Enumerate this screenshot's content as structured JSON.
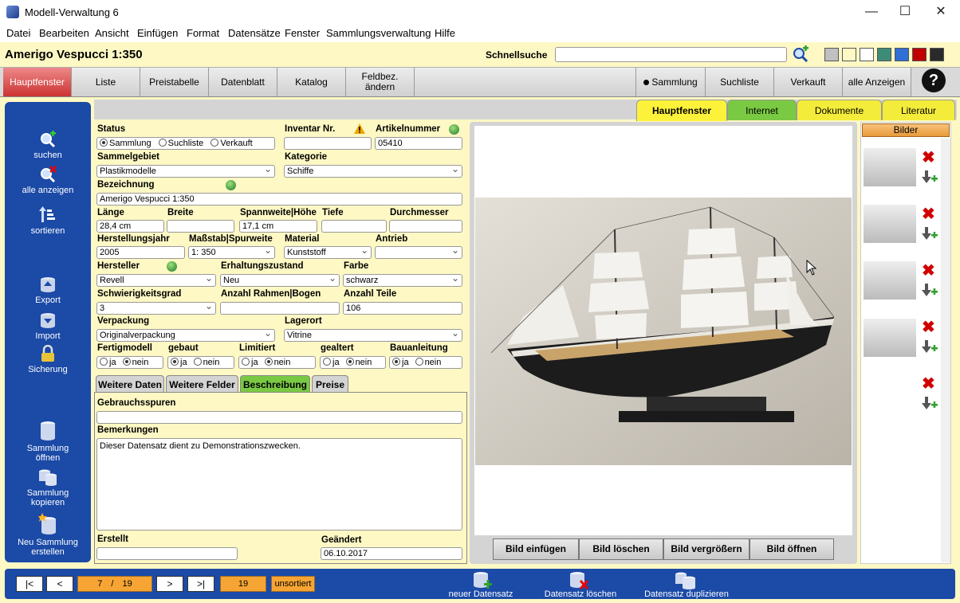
{
  "window": {
    "title": "Modell-Verwaltung 6",
    "min": "—",
    "max": "☐",
    "close": "✕"
  },
  "menu": [
    "Datei",
    "Bearbeiten",
    "Ansicht",
    "Einfügen",
    "Format",
    "Datensätze",
    "Fenster",
    "Sammlungsverwaltung",
    "Hilfe"
  ],
  "header": {
    "record_title": "Amerigo Vespucci 1:350",
    "quicksearch_label": "Schnellsuche",
    "quicksearch_value": ""
  },
  "swatches": [
    "#c0c0c0",
    "#fdf8c4",
    "#ffffff",
    "#3d8c7a",
    "#2f6fd6",
    "#c00000",
    "#2a2a2a"
  ],
  "nav": {
    "hauptfenster": "Hauptfenster",
    "liste": "Liste",
    "preistabelle": "Preistabelle",
    "datenblatt": "Datenblatt",
    "katalog": "Katalog",
    "feldbez1": "Feldbez.",
    "feldbez2": "ändern",
    "sammlung": "Sammlung",
    "suchliste": "Suchliste",
    "verkauft": "Verkauft",
    "alle": "alle Anzeigen",
    "help": "?"
  },
  "sidebar": {
    "suchen": "suchen",
    "alle": "alle anzeigen",
    "sortieren": "sortieren",
    "export": "Export",
    "import": "Import",
    "sicherung": "Sicherung",
    "oeffnen1": "Sammlung",
    "oeffnen2": "öffnen",
    "kopieren1": "Sammlung",
    "kopieren2": "kopieren",
    "neu1": "Neu Sammlung",
    "neu2": "erstellen"
  },
  "rtabs": {
    "haupt": "Hauptfenster",
    "internet": "Internet",
    "dokumente": "Dokumente",
    "literatur": "Literatur"
  },
  "form": {
    "status_label": "Status",
    "status_opts": [
      "Sammlung",
      "Suchliste",
      "Verkauft"
    ],
    "inventar_label": "Inventar Nr.",
    "inventar": "",
    "artikel_label": "Artikelnummer",
    "artikel": "05410",
    "sammelgebiet_label": "Sammelgebiet",
    "sammelgebiet": "Plastikmodelle",
    "kategorie_label": "Kategorie",
    "kategorie": "Schiffe",
    "bezeichnung_label": "Bezeichnung",
    "bezeichnung": "Amerigo Vespucci 1:350",
    "laenge_label": "Länge",
    "laenge": "28,4 cm",
    "breite_label": "Breite",
    "breite": "",
    "spann_label": "Spannweite|Höhe",
    "spann": "17,1 cm",
    "tiefe_label": "Tiefe",
    "tiefe": "",
    "durch_label": "Durchmesser",
    "durch": "",
    "jahr_label": "Herstellungsjahr",
    "jahr": "2005",
    "massstab_label": "Maßstab|Spurweite",
    "massstab": "1:  350",
    "material_label": "Material",
    "material": "Kunststoff",
    "antrieb_label": "Antrieb",
    "antrieb": "",
    "hersteller_label": "Hersteller",
    "hersteller": "Revell",
    "erhaltung_label": "Erhaltungszustand",
    "erhaltung": "Neu",
    "farbe_label": "Farbe",
    "farbe": "schwarz",
    "schwierig_label": "Schwierigkeitsgrad",
    "schwierig": "3",
    "rahmen_label": "Anzahl Rahmen|Bogen",
    "rahmen": "",
    "teile_label": "Anzahl Teile",
    "teile": "106",
    "verpackung_label": "Verpackung",
    "verpackung": "Originalverpackung",
    "lagerort_label": "Lagerort",
    "lagerort": "Vitrine",
    "fertig_label": "Fertigmodell",
    "gebaut_label": "gebaut",
    "limitiert_label": "Limitiert",
    "gealtert_label": "gealtert",
    "bauanl_label": "Bauanleitung",
    "ja": "ja",
    "nein": "nein",
    "tab1": "Weitere Daten",
    "tab2": "Weitere Felder",
    "tab3": "Beschreibung",
    "tab4": "Preise",
    "gebrauch_label": "Gebrauchsspuren",
    "gebrauch": "",
    "bemerk_label": "Bemerkungen",
    "bemerk": "Dieser Datensatz dient zu Demonstrationszwecken.",
    "erstellt_label": "Erstellt",
    "erstellt": "",
    "geaendert_label": "Geändert",
    "geaendert": "06.10.2017"
  },
  "image_buttons": {
    "einf": "Bild einfügen",
    "loesch": "Bild löschen",
    "vergr": "Bild vergrößern",
    "oeffnen": "Bild öffnen"
  },
  "bilder_label": "Bilder",
  "bottom": {
    "first": "|<",
    "prev": "<",
    "current": "7",
    "sep": "/",
    "total": "19",
    "next": ">",
    "last": ">|",
    "count": "19",
    "sort": "unsortiert",
    "neu": "neuer Datensatz",
    "loeschen": "Datensatz löschen",
    "dup": "Datensatz duplizieren"
  }
}
